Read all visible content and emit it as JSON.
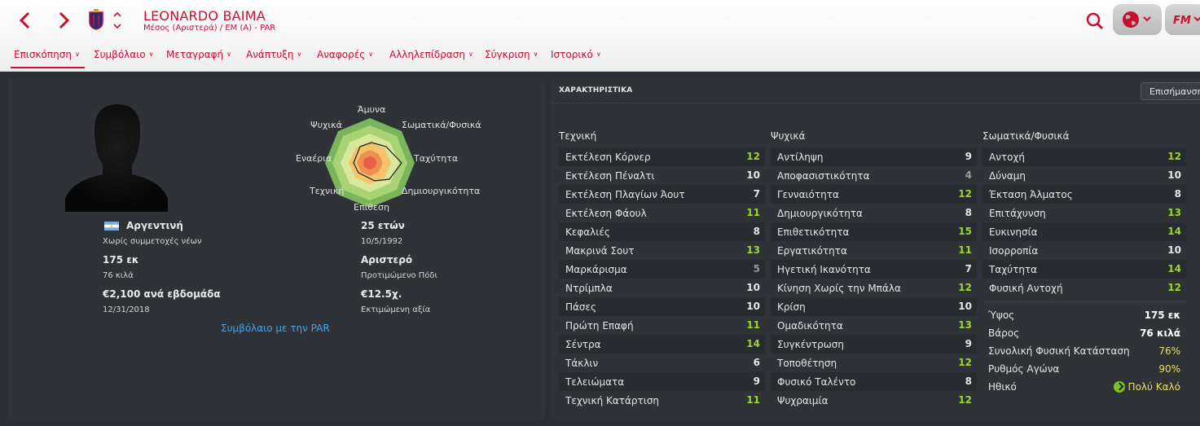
{
  "header": {
    "player_name": "LEONARDO BAIMA",
    "player_subtitle": "Μέσος (Αριστερά) / ΕΜ (Α) - PAR",
    "back_icon": "chevron-left-icon",
    "forward_icon": "chevron-right-icon",
    "search_icon": "search-icon",
    "globe_icon": "globe-icon",
    "fm_logo": "FM",
    "accent_color": "#c8102e"
  },
  "tabs": [
    {
      "label": "Επισκόπηση",
      "active": true
    },
    {
      "label": "Συμβόλαιο"
    },
    {
      "label": "Μεταγραφή"
    },
    {
      "label": "Ανάπτυξη"
    },
    {
      "label": "Αναφορές"
    },
    {
      "label": "Αλληλεπίδραση"
    },
    {
      "label": "Σύγκριση"
    },
    {
      "label": "Ιστορικό"
    }
  ],
  "profile": {
    "radar_labels": {
      "top": "Άμυνα",
      "top_left": "Ψυχικά",
      "top_right": "Σωματικά/Φυσικά",
      "left": "Εναέρια",
      "right": "Ταχύτητα",
      "bottom_left": "Τεχνική",
      "bottom_right": "Δημιουργικότητα",
      "bottom": "Επίθεση"
    },
    "nationality": "Αργεντινή",
    "youth_caps": "Χωρίς συμμετοχές νέων",
    "age": "25 ετών",
    "birth_date": "10/5/1992",
    "height": "175 εκ",
    "weight": "76 κιλά",
    "foot": "Αριστερό",
    "foot_label": "Προτιμώμενο Πόδι",
    "wage": "€2,100 ανά εβδομάδα",
    "contract_end": "12/31/2018",
    "value": "€12.5χ.",
    "value_label": "Εκτιμώμενη αξία",
    "contract_link": "Συμβόλαιο με την PAR"
  },
  "attributes": {
    "title": "ΧΑΡΑΚΤΗΡΙΣΤΙΚΑ",
    "highlight_button": "Επισήμανση",
    "technical_title": "Τεχνική",
    "technical": [
      {
        "name": "Εκτέλεση Κόρνερ",
        "value": "12"
      },
      {
        "name": "Εκτέλεση Πέναλτι",
        "value": "10"
      },
      {
        "name": "Εκτέλεση Πλαγίων Άουτ",
        "value": "7"
      },
      {
        "name": "Εκτέλεση Φάουλ",
        "value": "11"
      },
      {
        "name": "Κεφαλιές",
        "value": "8"
      },
      {
        "name": "Μακρινά Σουτ",
        "value": "13"
      },
      {
        "name": "Μαρκάρισμα",
        "value": "5"
      },
      {
        "name": "Ντρίμπλα",
        "value": "10"
      },
      {
        "name": "Πάσες",
        "value": "10"
      },
      {
        "name": "Πρώτη Επαφή",
        "value": "11"
      },
      {
        "name": "Σέντρα",
        "value": "14"
      },
      {
        "name": "Τάκλιν",
        "value": "6"
      },
      {
        "name": "Τελειώματα",
        "value": "9"
      },
      {
        "name": "Τεχνική Κατάρτιση",
        "value": "11"
      }
    ],
    "mental_title": "Ψυχικά",
    "mental": [
      {
        "name": "Αντίληψη",
        "value": "9"
      },
      {
        "name": "Αποφασιστικότητα",
        "value": "4"
      },
      {
        "name": "Γενναιότητα",
        "value": "12"
      },
      {
        "name": "Δημιουργικότητα",
        "value": "8"
      },
      {
        "name": "Επιθετικότητα",
        "value": "15"
      },
      {
        "name": "Εργατικότητα",
        "value": "11"
      },
      {
        "name": "Ηγετική Ικανότητα",
        "value": "7"
      },
      {
        "name": "Κίνηση Χωρίς την Μπάλα",
        "value": "12"
      },
      {
        "name": "Κρίση",
        "value": "10"
      },
      {
        "name": "Ομαδικότητα",
        "value": "13"
      },
      {
        "name": "Συγκέντρωση",
        "value": "9"
      },
      {
        "name": "Τοποθέτηση",
        "value": "12"
      },
      {
        "name": "Φυσικό Ταλέντο",
        "value": "8"
      },
      {
        "name": "Ψυχραιμία",
        "value": "12"
      }
    ],
    "physical_title": "Σωματικά/Φυσικά",
    "physical": [
      {
        "name": "Αντοχή",
        "value": "12"
      },
      {
        "name": "Δύναμη",
        "value": "10"
      },
      {
        "name": "Έκταση Άλματος",
        "value": "8"
      },
      {
        "name": "Επιτάχυνση",
        "value": "13"
      },
      {
        "name": "Ευκινησία",
        "value": "14"
      },
      {
        "name": "Ισορροπία",
        "value": "10"
      },
      {
        "name": "Ταχύτητα",
        "value": "14"
      },
      {
        "name": "Φυσική Αντοχή",
        "value": "12"
      }
    ],
    "physique": {
      "height_label": "Ύψος",
      "height": "175 εκ",
      "weight_label": "Βάρος",
      "weight": "76 κιλά",
      "condition_label": "Συνολική Φυσική Κατάσταση",
      "condition": "76%",
      "match_fitness_label": "Ρυθμός Αγώνα",
      "match_fitness": "90%",
      "morale_label": "Ηθικό",
      "morale": "Πολύ Καλό"
    }
  }
}
